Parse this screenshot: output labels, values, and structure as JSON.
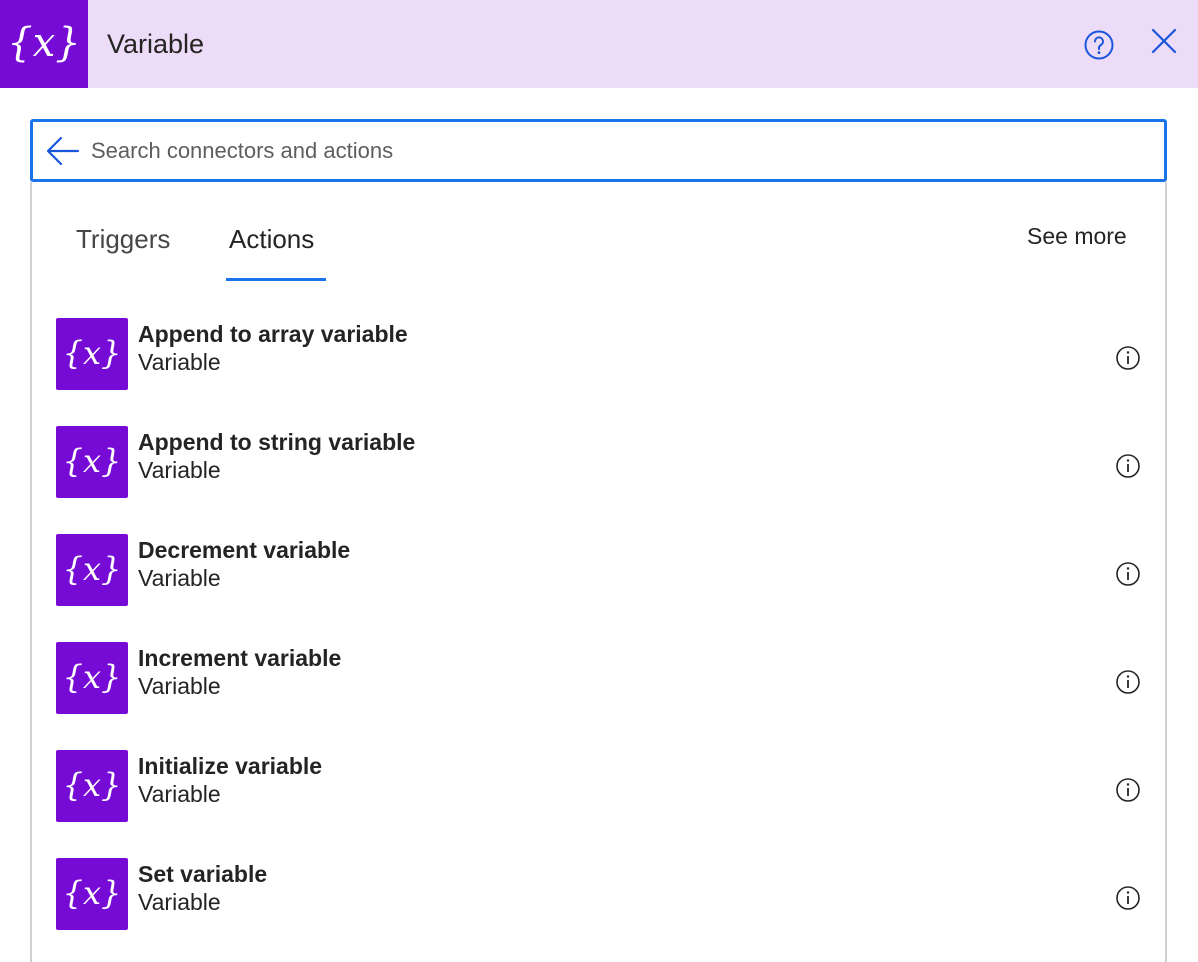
{
  "header": {
    "title": "Variable",
    "logo_icon": "curly-x-icon",
    "help_icon": "help-icon",
    "close_icon": "close-icon",
    "background": "#ecdcf8",
    "brand_color": "#770bd6"
  },
  "search": {
    "placeholder": "Search connectors and actions",
    "value": "",
    "back_icon": "arrow-left-icon",
    "border_color": "#1a73e8"
  },
  "tabs": [
    {
      "label": "Triggers",
      "selected": false
    },
    {
      "label": "Actions",
      "selected": true
    }
  ],
  "see_more_label": "See more",
  "actions": [
    {
      "title": "Append to array variable",
      "subtitle": "Variable",
      "icon": "curly-x-icon"
    },
    {
      "title": "Append to string variable",
      "subtitle": "Variable",
      "icon": "curly-x-icon"
    },
    {
      "title": "Decrement variable",
      "subtitle": "Variable",
      "icon": "curly-x-icon"
    },
    {
      "title": "Increment variable",
      "subtitle": "Variable",
      "icon": "curly-x-icon"
    },
    {
      "title": "Initialize variable",
      "subtitle": "Variable",
      "icon": "curly-x-icon"
    },
    {
      "title": "Set variable",
      "subtitle": "Variable",
      "icon": "curly-x-icon"
    }
  ]
}
